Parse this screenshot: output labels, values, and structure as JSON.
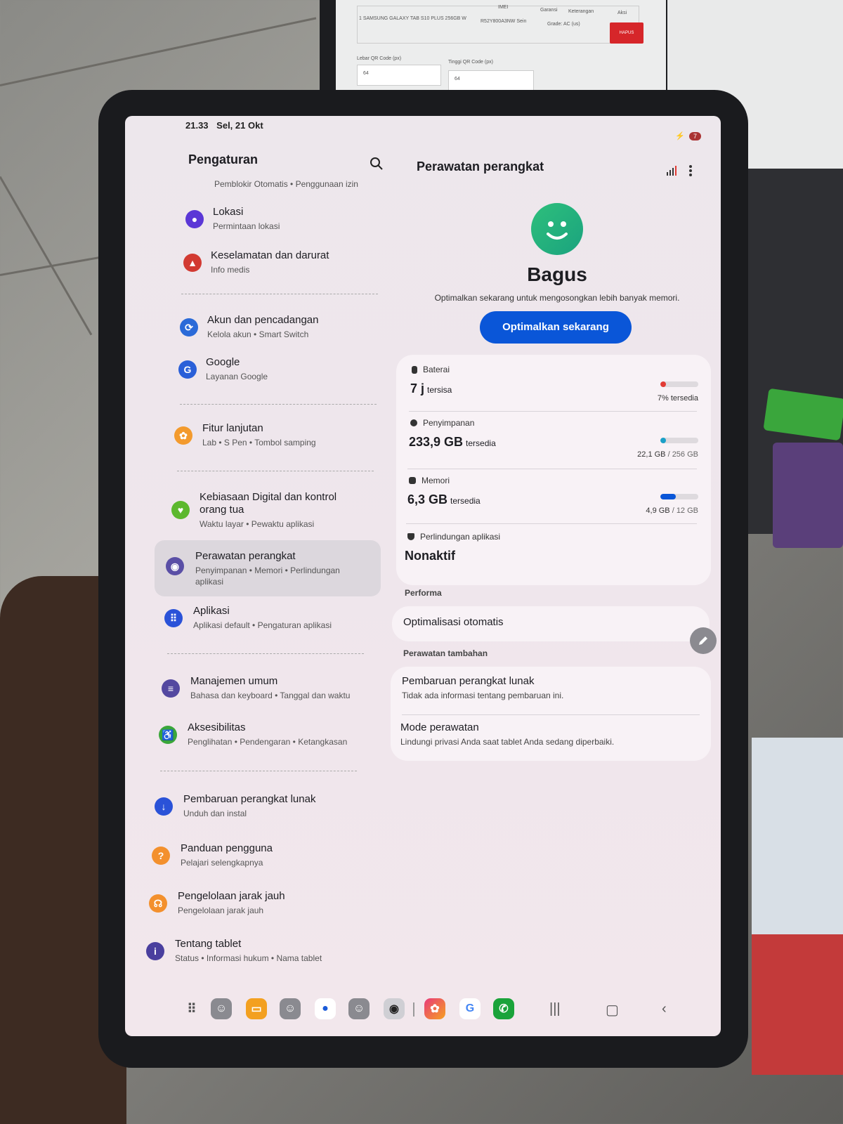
{
  "monitor": {
    "header_imei": "IMEI",
    "header_garansi": "Garansi",
    "header_keterangan": "Keterangan",
    "header_aksi": "Aksi",
    "row": "1  SAMSUNG GALAXY TAB S10 PLUS 256GB W",
    "row_imei": "R52Y800A3NW Sein",
    "row_grade": "Grade: AC (us)",
    "hapus": "HAPUS",
    "qr_width_label": "Lebar QR Code (px)",
    "qr_height_label": "Tinggi QR Code (px)",
    "qr_width": "64",
    "qr_height": "64"
  },
  "status_bar": {
    "time": "21.33",
    "date": "Sel, 21 Okt",
    "battery": "7"
  },
  "left": {
    "title": "Pengaturan",
    "partial_sub": "Pemblokir Otomatis  •  Penggunaan izin",
    "items": [
      {
        "title": "Lokasi",
        "sub": "Permintaan lokasi",
        "icon": "location-icon",
        "color": "#5b37d6"
      },
      {
        "title": "Keselamatan dan darurat",
        "sub": "Info medis",
        "icon": "emergency-icon",
        "color": "#d23a32"
      },
      {
        "title": "Akun dan pencadangan",
        "sub": "Kelola akun  •  Smart Switch",
        "icon": "sync-icon",
        "color": "#2a6ad8"
      },
      {
        "title": "Google",
        "sub": "Layanan Google",
        "icon": "google-icon",
        "color": "#2a5fd8"
      },
      {
        "title": "Fitur lanjutan",
        "sub": "Lab  •  S Pen  •  Tombol samping",
        "icon": "gear-plus-icon",
        "color": "#f39a2d"
      },
      {
        "title": "Kebiasaan Digital dan kontrol",
        "title2": "orang tua",
        "sub": "Waktu layar  •  Pewaktu aplikasi",
        "icon": "wellbeing-icon",
        "color": "#5cb82e"
      },
      {
        "title": "Perawatan perangkat",
        "sub": "Penyimpanan  •  Memori  •  Perlindungan",
        "sub2": "aplikasi",
        "icon": "device-care-icon",
        "color": "#5a4fa6"
      },
      {
        "title": "Aplikasi",
        "sub": "Aplikasi default  •  Pengaturan aplikasi",
        "icon": "apps-icon",
        "color": "#2a52d8"
      },
      {
        "title": "Manajemen umum",
        "sub": "Bahasa dan keyboard  •  Tanggal dan waktu",
        "icon": "sliders-icon",
        "color": "#5448a0"
      },
      {
        "title": "Aksesibilitas",
        "sub": "Penglihatan  •  Pendengaran  •  Ketangkasan",
        "icon": "accessibility-icon",
        "color": "#3aa63a"
      },
      {
        "title": "Pembaruan perangkat lunak",
        "sub": "Unduh dan instal",
        "icon": "update-icon",
        "color": "#2a52d8"
      },
      {
        "title": "Panduan pengguna",
        "sub": "Pelajari selengkapnya",
        "icon": "guide-icon",
        "color": "#f3902d"
      },
      {
        "title": "Pengelolaan jarak jauh",
        "sub": "Pengelolaan jarak jauh",
        "icon": "headset-icon",
        "color": "#f3902d"
      },
      {
        "title": "Tentang tablet",
        "sub": "Status  •  Informasi hukum  •  Nama tablet",
        "icon": "info-icon",
        "color": "#4a3f9e"
      }
    ]
  },
  "right": {
    "title": "Perawatan perangkat",
    "status": "Bagus",
    "status_desc": "Optimalkan sekarang untuk mengosongkan lebih banyak memori.",
    "optimize_button": "Optimalkan sekarang",
    "battery": {
      "label": "Baterai",
      "value": "7 j",
      "unit": "tersisa",
      "note": "7% tersedia",
      "fill": 0.07,
      "color": "#e23b34"
    },
    "storage": {
      "label": "Penyimpanan",
      "value": "233,9 GB",
      "unit": "tersedia",
      "note_used": "22,1 GB",
      "note_total": "/ 256 GB",
      "fill": 0.086,
      "color": "#1aa0c8"
    },
    "memory": {
      "label": "Memori",
      "value": "6,3 GB",
      "unit": "tersedia",
      "note_used": "4,9 GB",
      "note_total": "/ 12 GB",
      "fill": 0.41,
      "color": "#0a56d8"
    },
    "protection": {
      "label": "Perlindungan aplikasi",
      "value": "Nonaktif"
    },
    "performance_section": "Performa",
    "auto_optimize": "Optimalisasi otomatis",
    "additional_section": "Perawatan tambahan",
    "software_update": {
      "title": "Pembaruan perangkat lunak",
      "sub": "Tidak ada informasi tentang pembaruan ini."
    },
    "maintenance_mode": {
      "title": "Mode perawatan",
      "sub": "Lindungi privasi Anda saat tablet Anda sedang diperbaiki."
    }
  },
  "dock": {
    "apps": [
      "app-drawer-icon",
      "android-app-icon",
      "my-files-icon",
      "android-app-icon",
      "messages-icon",
      "android-app-icon",
      "camera-icon",
      "gallery-icon",
      "google-icon",
      "phone-icon"
    ]
  }
}
